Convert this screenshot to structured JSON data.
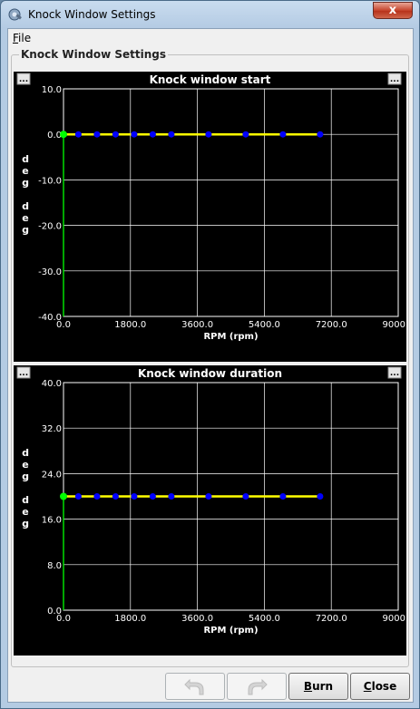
{
  "window": {
    "title": "Knock Window Settings",
    "close_glyph": "x"
  },
  "menu": {
    "file_mnemonic": "F",
    "file_rest": "ile"
  },
  "group": {
    "title": "Knock Window Settings"
  },
  "charts": [
    {
      "title": "Knock window start",
      "options_left": "...",
      "options_right": "...",
      "ylabel": [
        "d",
        "e",
        "g",
        "",
        "d",
        "e",
        "g"
      ],
      "xlabel": "RPM (rpm)"
    },
    {
      "title": "Knock window duration",
      "options_left": "...",
      "options_right": "...",
      "ylabel": [
        "d",
        "e",
        "g",
        "",
        "d",
        "e",
        "g"
      ],
      "xlabel": "RPM (rpm)"
    }
  ],
  "chart_data": [
    {
      "type": "line",
      "title": "Knock window start",
      "xlabel": "RPM (rpm)",
      "ylabel": "deg deg",
      "x_ticks": [
        "0.0",
        "1800.0",
        "3600.0",
        "5400.0",
        "7200.0",
        "9000.0"
      ],
      "y_ticks": [
        "10.0",
        "0.0",
        "-10.0",
        "-20.0",
        "-30.0",
        "-40.0"
      ],
      "xlim": [
        0,
        9000
      ],
      "ylim": [
        -40,
        10
      ],
      "grid": true,
      "x": [
        400,
        900,
        1400,
        1900,
        2400,
        2900,
        3900,
        4900,
        5900,
        6900
      ],
      "values": [
        0,
        0,
        0,
        0,
        0,
        0,
        0,
        0,
        0,
        0
      ],
      "marker_x0_value": 0,
      "colors": {
        "line": "#ffff00",
        "points": "#0000ff",
        "axis_marker": "#00ff00",
        "background": "#000000",
        "grid": "#ffffff"
      }
    },
    {
      "type": "line",
      "title": "Knock window duration",
      "xlabel": "RPM (rpm)",
      "ylabel": "deg deg",
      "x_ticks": [
        "0.0",
        "1800.0",
        "3600.0",
        "5400.0",
        "7200.0",
        "9000.0"
      ],
      "y_ticks": [
        "40.0",
        "32.0",
        "24.0",
        "16.0",
        "8.0",
        "0.0"
      ],
      "xlim": [
        0,
        9000
      ],
      "ylim": [
        0,
        40
      ],
      "grid": true,
      "x": [
        400,
        900,
        1400,
        1900,
        2400,
        2900,
        3900,
        4900,
        5900,
        6900
      ],
      "values": [
        20,
        20,
        20,
        20,
        20,
        20,
        20,
        20,
        20,
        20
      ],
      "marker_x0_value": 20,
      "colors": {
        "line": "#ffff00",
        "points": "#0000ff",
        "axis_marker": "#00ff00",
        "background": "#000000",
        "grid": "#ffffff"
      }
    }
  ],
  "buttons": {
    "undo_icon": "undo-arrow-icon",
    "redo_icon": "redo-arrow-icon",
    "burn_mnemonic": "B",
    "burn_rest": "urn",
    "close_mnemonic": "C",
    "close_rest": "lose"
  }
}
